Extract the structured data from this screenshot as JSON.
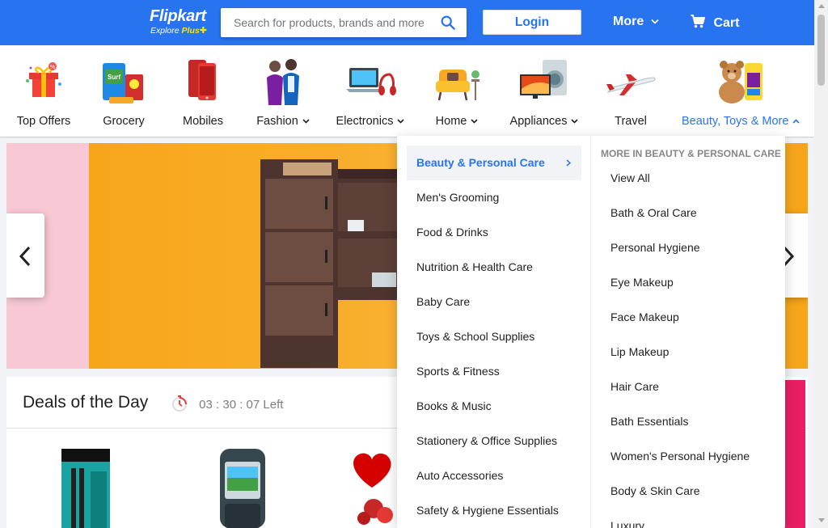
{
  "header": {
    "brand": "Flipkart",
    "tagline_explore": "Explore",
    "tagline_plus": "Plus",
    "search_placeholder": "Search for products, brands and more",
    "login_label": "Login",
    "more_label": "More",
    "cart_label": "Cart"
  },
  "categories": [
    {
      "label": "Top Offers",
      "icon": "gift-icon",
      "has_dropdown": false
    },
    {
      "label": "Grocery",
      "icon": "grocery-icon",
      "has_dropdown": false
    },
    {
      "label": "Mobiles",
      "icon": "mobile-phone-icon",
      "has_dropdown": false
    },
    {
      "label": "Fashion",
      "icon": "fashion-models-icon",
      "has_dropdown": true
    },
    {
      "label": "Electronics",
      "icon": "laptop-headphones-icon",
      "has_dropdown": true
    },
    {
      "label": "Home",
      "icon": "armchair-icon",
      "has_dropdown": true
    },
    {
      "label": "Appliances",
      "icon": "tv-washing-machine-icon",
      "has_dropdown": true
    },
    {
      "label": "Travel",
      "icon": "airplane-icon",
      "has_dropdown": false
    },
    {
      "label": "Beauty, Toys & More",
      "icon": "teddy-bear-icon",
      "has_dropdown": true,
      "active": true
    }
  ],
  "deals": {
    "title": "Deals of the Day",
    "timer": "03 : 30 : 07 Left"
  },
  "dropdown": {
    "left_items": [
      "Beauty & Personal Care",
      "Men's Grooming",
      "Food & Drinks",
      "Nutrition & Health Care",
      "Baby Care",
      "Toys & School Supplies",
      "Sports & Fitness",
      "Books & Music",
      "Stationery & Office Supplies",
      "Auto Accessories",
      "Safety & Hygiene Essentials"
    ],
    "selected_index": 0,
    "right_heading": "MORE IN BEAUTY & PERSONAL CARE",
    "right_items": [
      "View All",
      "Bath & Oral Care",
      "Personal Hygiene",
      "Eye Makeup",
      "Face Makeup",
      "Lip Makeup",
      "Hair Care",
      "Bath Essentials",
      "Women's Personal Hygiene",
      "Body & Skin Care",
      "Luxury"
    ]
  },
  "colors": {
    "brand_blue": "#2874f0",
    "brand_yellow": "#ffe500",
    "page_bg": "#f1f3f6"
  }
}
